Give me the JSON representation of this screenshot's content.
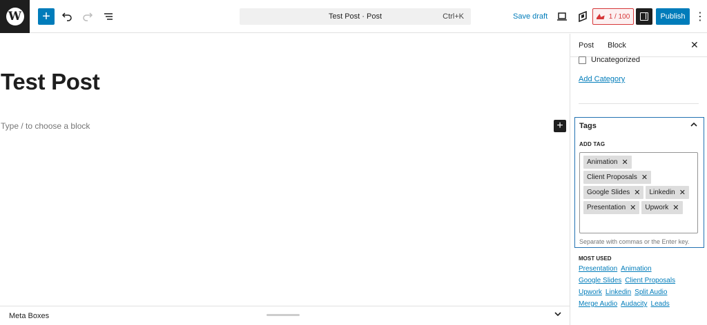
{
  "toolbar": {
    "wp_logo": "W",
    "inserter_icon": "plus-icon",
    "command_title": "Test Post · Post",
    "command_shortcut": "Ctrl+K",
    "save_draft_label": "Save draft",
    "grammar_score": "1 / 100",
    "publish_label": "Publish",
    "more_icon": "⋮"
  },
  "editor": {
    "title": "Test Post",
    "placeholder": "Type / to choose a block"
  },
  "meta_boxes": {
    "label": "Meta Boxes"
  },
  "sidebar": {
    "tabs": {
      "post": "Post",
      "block": "Block"
    },
    "close_icon": "✕",
    "category": {
      "label": "Uncategorized",
      "checked": false
    },
    "add_category_label": "Add Category",
    "tags": {
      "heading": "Tags",
      "add_tag_label": "ADD TAG",
      "tokens": [
        "Animation",
        "Client Proposals",
        "Google Slides",
        "Linkedin",
        "Presentation",
        "Upwork"
      ],
      "help": "Separate with commas or the Enter key."
    },
    "most_used": {
      "label": "MOST USED",
      "links": [
        "Presentation",
        "Animation",
        "Google Slides",
        "Client Proposals",
        "Upwork",
        "Linkedin",
        "Split Audio",
        "Merge Audio",
        "Audacity",
        "Leads"
      ]
    }
  },
  "colors": {
    "accent": "#007cba",
    "dark": "#1e1e1e",
    "panel_border": "#2271b1",
    "grammar_red": "#d63638"
  }
}
